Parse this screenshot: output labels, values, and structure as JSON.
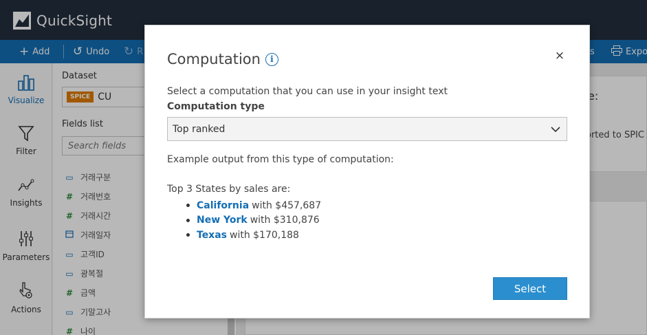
{
  "app": {
    "name": "QuickSight"
  },
  "toolbar": {
    "add_label": "Add",
    "undo_label": "Undo",
    "redo_partial": "R",
    "right_partial_1": "s",
    "export_partial": "Expo"
  },
  "nav": {
    "items": [
      {
        "label": "Visualize",
        "icon": "bar-chart-icon",
        "active": true
      },
      {
        "label": "Filter",
        "icon": "funnel-icon"
      },
      {
        "label": "Insights",
        "icon": "line-chart-icon"
      },
      {
        "label": "Parameters",
        "icon": "sliders-icon"
      },
      {
        "label": "Actions",
        "icon": "pointer-gear-icon"
      }
    ]
  },
  "data_panel": {
    "dataset_title": "Dataset",
    "spice_badge": "SPICE",
    "dataset_name": "CU",
    "fields_title": "Fields list",
    "search_placeholder": "Search fields",
    "fields": [
      {
        "name": "거래구분",
        "type": "dimension"
      },
      {
        "name": "거래번호",
        "type": "measure"
      },
      {
        "name": "거래시간",
        "type": "measure"
      },
      {
        "name": "거래일자",
        "type": "date"
      },
      {
        "name": "고객ID",
        "type": "dimension"
      },
      {
        "name": "광복절",
        "type": "dimension"
      },
      {
        "name": "금액",
        "type": "measure"
      },
      {
        "name": "기말고사",
        "type": "dimension"
      },
      {
        "name": "나이",
        "type": "measure"
      }
    ]
  },
  "background": {
    "peek_text_1": "e:",
    "peek_text_2": "orted to SPIC"
  },
  "modal": {
    "title": "Computation",
    "close_label": "×",
    "description": "Select a computation that you can use in your insight text",
    "type_label": "Computation type",
    "selected_type": "Top ranked",
    "example_heading": "Example output from this type of computation:",
    "sample_intro": "Top 3 States by sales are:",
    "sample_items": [
      {
        "state": "California",
        "rest": "with $457,687"
      },
      {
        "state": "New York",
        "rest": "with $310,876"
      },
      {
        "state": "Texas",
        "rest": "with $170,188"
      }
    ],
    "select_button": "Select"
  },
  "colors": {
    "header_bg": "#232f3e",
    "toolbar_bg": "#146eb4",
    "accent": "#146eb4",
    "primary_button": "#2b8fcf",
    "spice_badge": "#e07b00"
  }
}
